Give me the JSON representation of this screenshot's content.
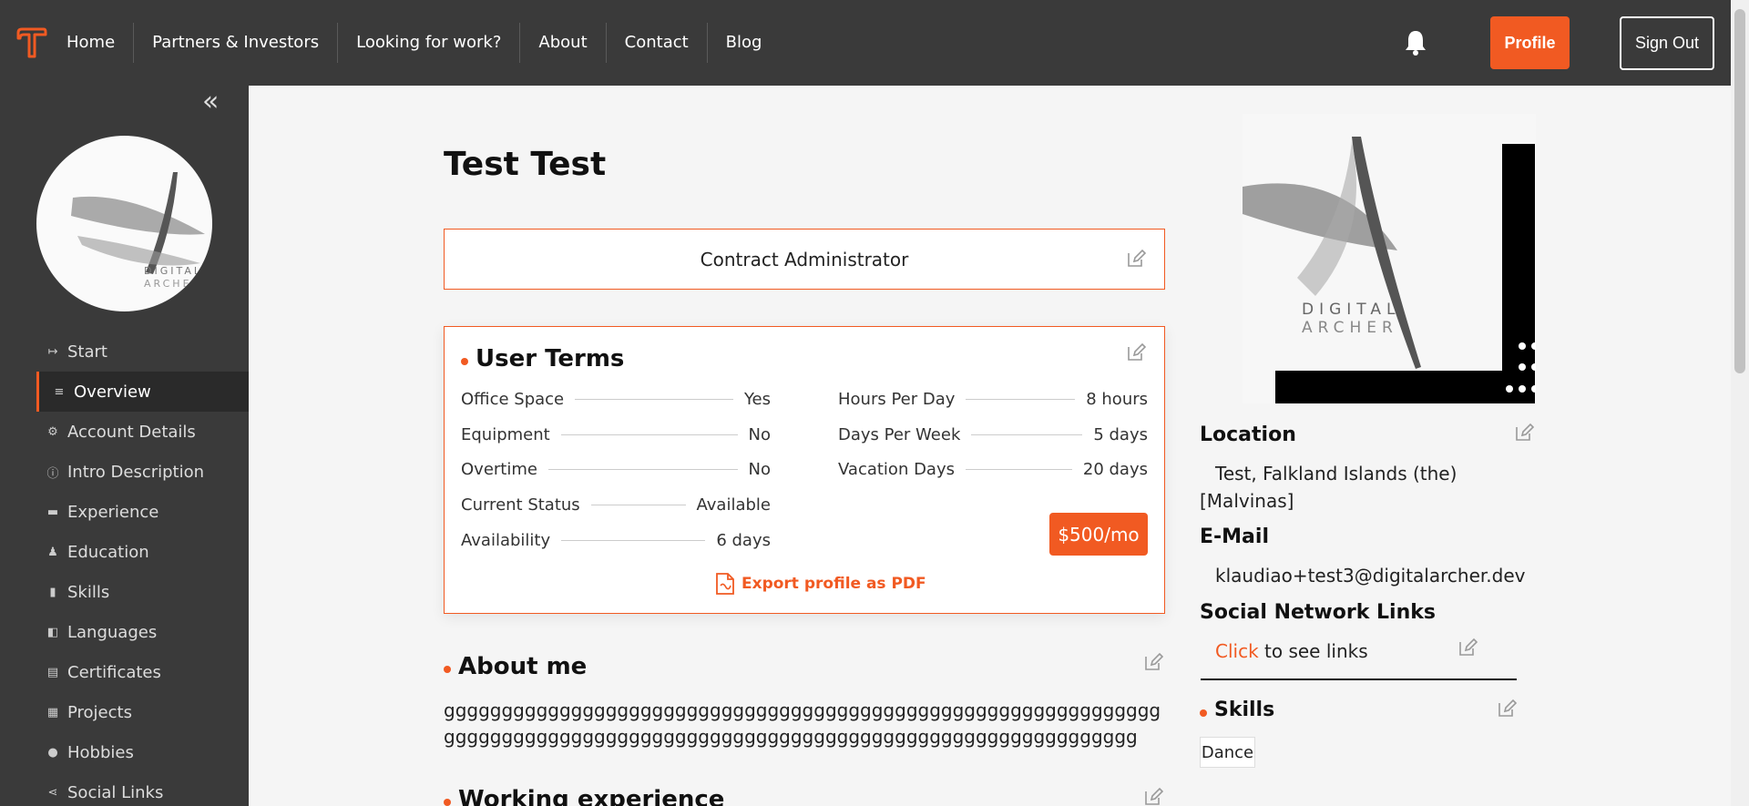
{
  "nav": {
    "items": [
      "Home",
      "Partners & Investors",
      "Looking for work?",
      "About",
      "Contact",
      "Blog"
    ],
    "profile_label": "Profile",
    "signout_label": "Sign Out"
  },
  "sidebar": {
    "items": [
      {
        "label": "Start",
        "icon": "arrow-right-icon"
      },
      {
        "label": "Overview",
        "icon": "list-icon",
        "active": true
      },
      {
        "label": "Account Details",
        "icon": "gear-icon"
      },
      {
        "label": "Intro Description",
        "icon": "info-icon"
      },
      {
        "label": "Experience",
        "icon": "briefcase-icon"
      },
      {
        "label": "Education",
        "icon": "graduation-icon"
      },
      {
        "label": "Skills",
        "icon": "bar-chart-icon"
      },
      {
        "label": "Languages",
        "icon": "chat-icon"
      },
      {
        "label": "Certificates",
        "icon": "certificate-icon"
      },
      {
        "label": "Projects",
        "icon": "presentation-icon"
      },
      {
        "label": "Hobbies",
        "icon": "user-icon"
      },
      {
        "label": "Social Links",
        "icon": "share-icon"
      }
    ]
  },
  "profile": {
    "name": "Test Test",
    "job_title": "Contract Administrator"
  },
  "terms": {
    "title": "User Terms",
    "left": [
      {
        "label": "Office Space",
        "value": "Yes"
      },
      {
        "label": "Equipment",
        "value": "No"
      },
      {
        "label": "Overtime",
        "value": "No"
      },
      {
        "label": "Current Status",
        "value": "Available"
      },
      {
        "label": "Availability",
        "value": "6 days"
      }
    ],
    "right": [
      {
        "label": "Hours Per Day",
        "value": "8 hours"
      },
      {
        "label": "Days Per Week",
        "value": "5 days"
      },
      {
        "label": "Vacation Days",
        "value": "20 days"
      }
    ],
    "price": "$500/mo",
    "export_label": "Export profile as PDF"
  },
  "about": {
    "title": "About me",
    "text": "gggggggggggggggggggggggggggggggggggggggggggggggggggggggggggggggggggggggggggggggggggggggggggggggggggggggggggggggggggggggggg"
  },
  "work": {
    "title": "Working experience"
  },
  "right": {
    "logo_text": [
      "DIGITAL",
      "ARCHER"
    ],
    "location_title": "Location",
    "location_value": "Test, Falkland Islands (the) [Malvinas]",
    "email_title": "E-Mail",
    "email_value": "klaudiao+test3@digitalarcher.dev",
    "social_title": "Social Network Links",
    "social_click": "Click",
    "social_rest": "to see links",
    "skills_title": "Skills",
    "skills": [
      "Dance"
    ]
  },
  "colors": {
    "accent": "#f15a22",
    "dark": "#3a3a3a"
  }
}
